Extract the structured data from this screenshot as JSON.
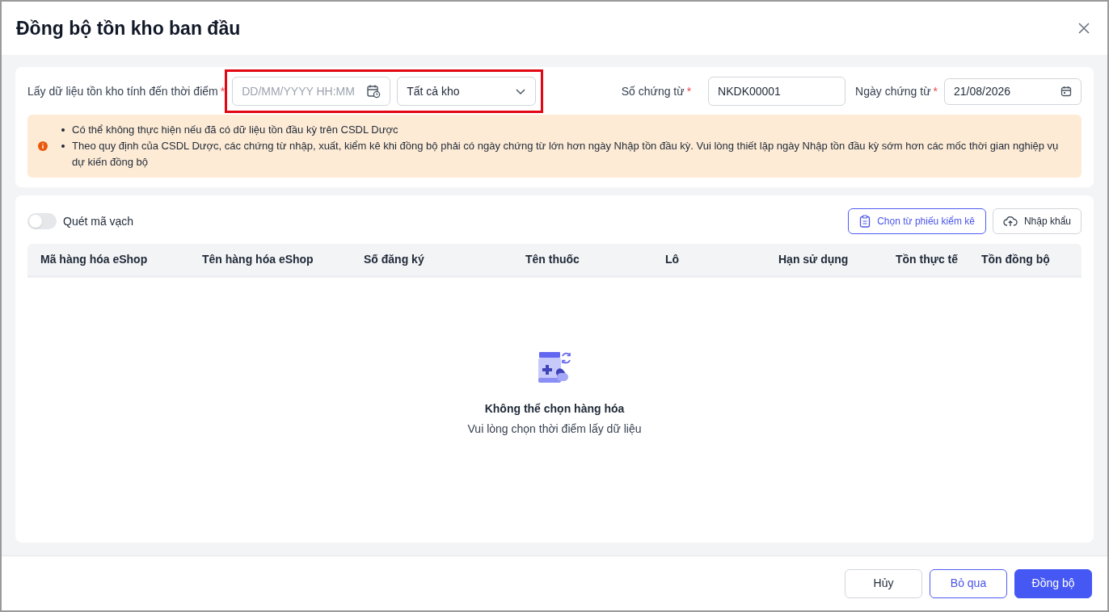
{
  "dialog": {
    "title": "Đồng bộ tồn kho ban đầu"
  },
  "filters": {
    "time_label": "Lấy dữ liệu tồn kho tính đến thời điểm",
    "time_mark": "*",
    "time_placeholder": "DD/MM/YYYY HH:MM",
    "warehouse": "Tất cả kho",
    "highlighted": true,
    "doc_number_label": "Số chứng từ",
    "doc_number_mark": "*",
    "doc_number": "NKDK00001",
    "doc_date_label": "Ngày chứng từ",
    "doc_date_mark": "*",
    "doc_date": "21/08/2026"
  },
  "notice": [
    "Có thể không thực hiện nếu đã có dữ liệu tồn đầu kỳ trên CSDL Dược",
    "Theo quy định của CSDL Dược, các chứng từ nhập, xuất, kiểm kê khi đồng bộ phải có ngày chứng từ lớn hơn ngày Nhập tồn đầu kỳ. Vui lòng thiết lập ngày Nhập tồn đầu kỳ sớm hơn các mốc thời gian nghiệp vụ dự kiến đồng bộ"
  ],
  "barcode_toggle": {
    "label": "Quét mã vạch",
    "on": false
  },
  "toolbar": [
    "Chọn từ phiếu kiểm kê",
    "Nhập khẩu"
  ],
  "table": {
    "columns": [
      "Mã hàng hóa eShop",
      "Tên hàng hóa eShop",
      "Số đăng ký",
      "Tên thuốc",
      "Lô",
      "Hạn sử dụng",
      "Tồn thực tế",
      "Tồn đồng bộ"
    ]
  },
  "empty": {
    "title": "Không thể chọn hàng hóa",
    "message": "Vui lòng chọn thời điểm lấy dữ liệu"
  },
  "footer": [
    {
      "label": "Hủy",
      "kind": "plain"
    },
    {
      "label": "Bỏ qua",
      "kind": "outline"
    },
    {
      "label": "Đồng bộ",
      "kind": "primary"
    }
  ]
}
